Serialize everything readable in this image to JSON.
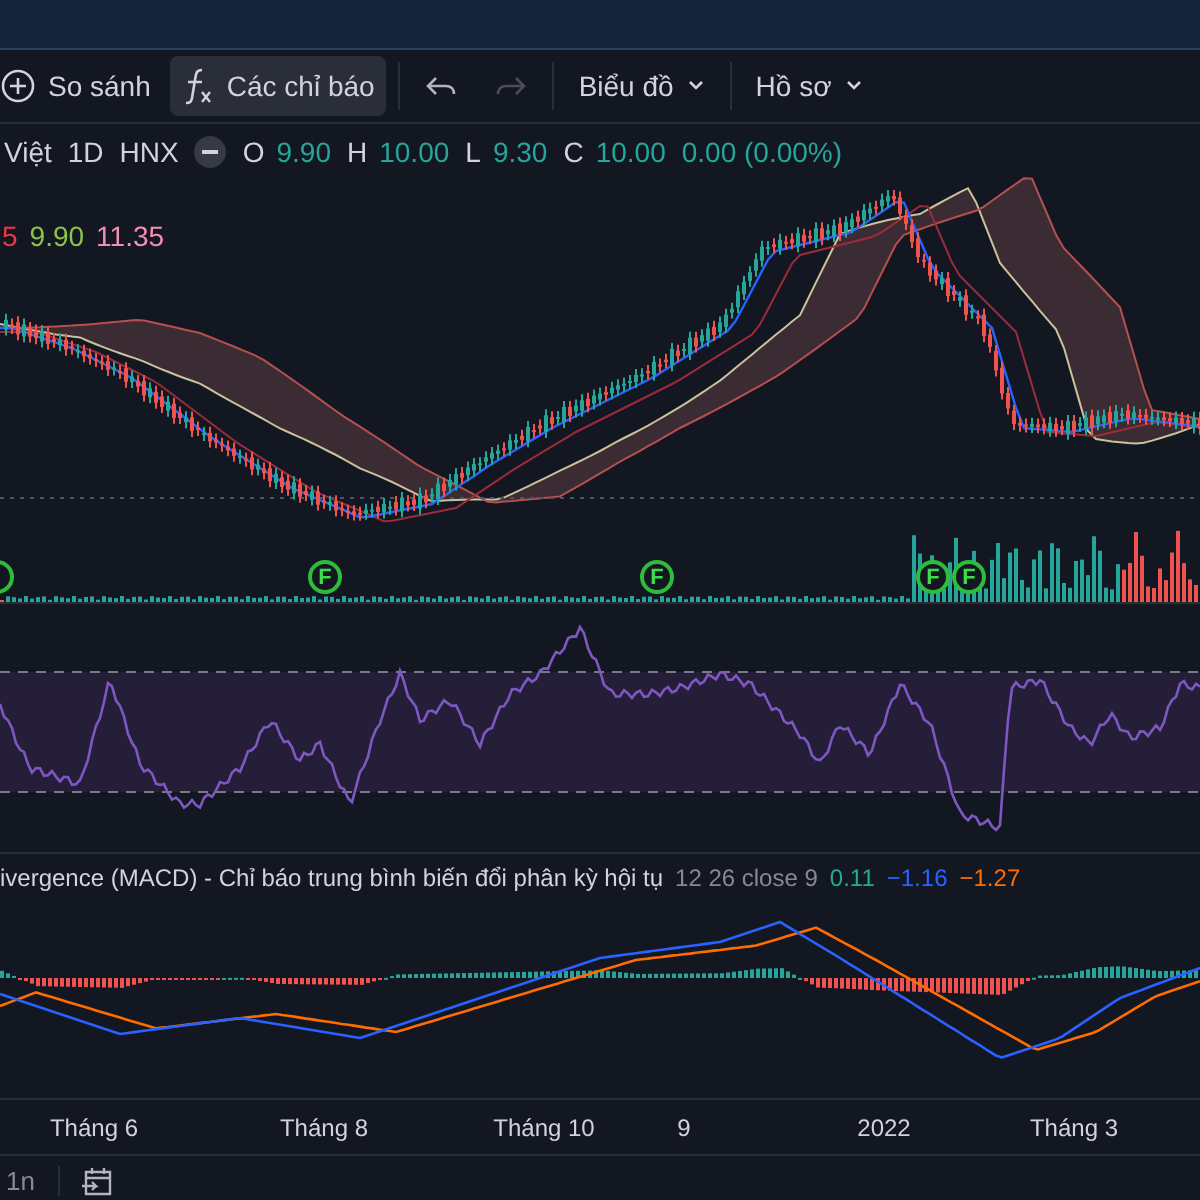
{
  "toolbar": {
    "items": [
      {
        "kind": "compare",
        "label": "So sánh",
        "selected": false
      },
      {
        "kind": "indicators",
        "label": "Các chỉ báo",
        "selected": true
      },
      {
        "kind": "undo",
        "disabled": false
      },
      {
        "kind": "redo",
        "disabled": true
      },
      {
        "kind": "menu",
        "label": "Biểu đồ",
        "selected": false
      },
      {
        "kind": "menu",
        "label": "Hồ sơ",
        "selected": false
      }
    ]
  },
  "symbol": {
    "name": "Việt",
    "interval": "1D",
    "exchange": "HNX",
    "ohlc": [
      {
        "label": "O",
        "value": "9.90"
      },
      {
        "label": "H",
        "value": "10.00"
      },
      {
        "label": "L",
        "value": "9.30"
      },
      {
        "label": "C",
        "value": "10.00"
      }
    ],
    "change": "0.00 (0.00%)"
  },
  "indicator_values": [
    {
      "text": "5",
      "color": "#f23645"
    },
    {
      "text": "9.90",
      "color": "#8bc34a"
    },
    {
      "text": "11.35",
      "color": "#f48fb1"
    }
  ],
  "event_markers": [
    "F",
    "F",
    "F",
    "F"
  ],
  "macd_legend": {
    "title": "ivergence (MACD) - Chỉ báo trung bình biến đổi phân kỳ hội tụ",
    "params": "12 26 close 9",
    "values": [
      {
        "text": "0.11",
        "color": "#22ab94"
      },
      {
        "text": "−1.16",
        "color": "#2962ff"
      },
      {
        "text": "−1.27",
        "color": "#ff6d00"
      }
    ]
  },
  "time_axis": [
    "Tháng 6",
    "Tháng 8",
    "Tháng 10",
    "9",
    "2022",
    "Tháng 3"
  ],
  "bottom_bar": {
    "range": "1n"
  }
}
